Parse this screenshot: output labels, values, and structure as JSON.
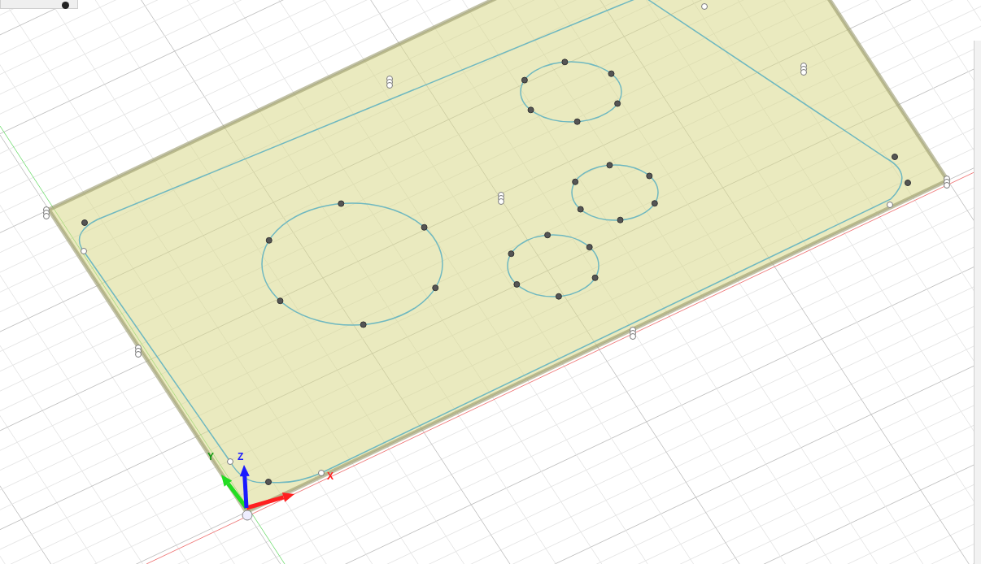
{
  "viewport": {
    "axes": [
      {
        "kind": "x",
        "label": "X"
      },
      {
        "kind": "y",
        "label": "Y"
      },
      {
        "kind": "z",
        "label": "Z"
      }
    ]
  }
}
